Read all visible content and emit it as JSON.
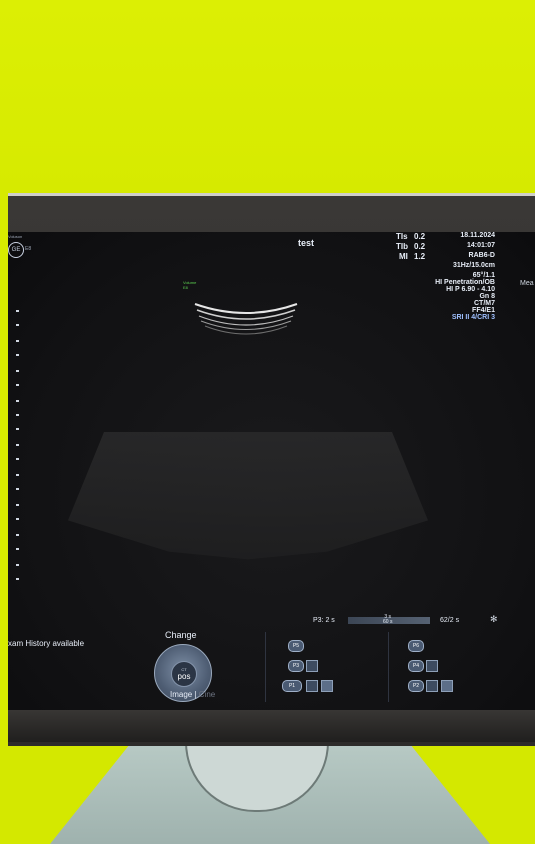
{
  "header": {
    "vendor_label": "Voluson",
    "logo_text": "GE",
    "logo_sub": "E8",
    "study_name": "test",
    "tis_label": "TIs",
    "tis_value": "0.2",
    "tib_label": "TIb",
    "tib_value": "0.2",
    "mi_label": "MI",
    "mi_value": "1.2",
    "date": "18.11.2024",
    "time": "14:01:07",
    "probe": "RAB6-D",
    "frame_depth": "31Hz/15.0cm",
    "angle": "65°/1.1",
    "preset": "HI Penetration/OB",
    "hi_p": "HI P 6.90 - 4.10",
    "gain": "Gn  8",
    "ct": "CT/M7",
    "ff": "FF4/E1",
    "sri": "SRI II 4/CRI 3",
    "right_edge": "Mea"
  },
  "image_area": {
    "volume_label_line1": "Volume",
    "volume_label_line2": "E8"
  },
  "bottom": {
    "exam_history": "xam History available",
    "change_label": "Change",
    "knob_top": "CT",
    "knob_label": "pos",
    "image_label": "Image",
    "cine_label": "Cine",
    "cine_prefix": "P3:",
    "cine_start": "2 s",
    "cine_mid_top": "3 s",
    "cine_mid_bottom": "60 s",
    "frames": "62/2 s",
    "gear_icon": "gear-icon"
  },
  "presets_left": [
    "P5",
    "P3",
    "P1"
  ],
  "presets_right": [
    "P6",
    "P4",
    "P2"
  ],
  "colors": {
    "wall": "#d8ec00",
    "screen": "#111113",
    "text": "#e8eef8",
    "accent_green": "#5cd050"
  }
}
